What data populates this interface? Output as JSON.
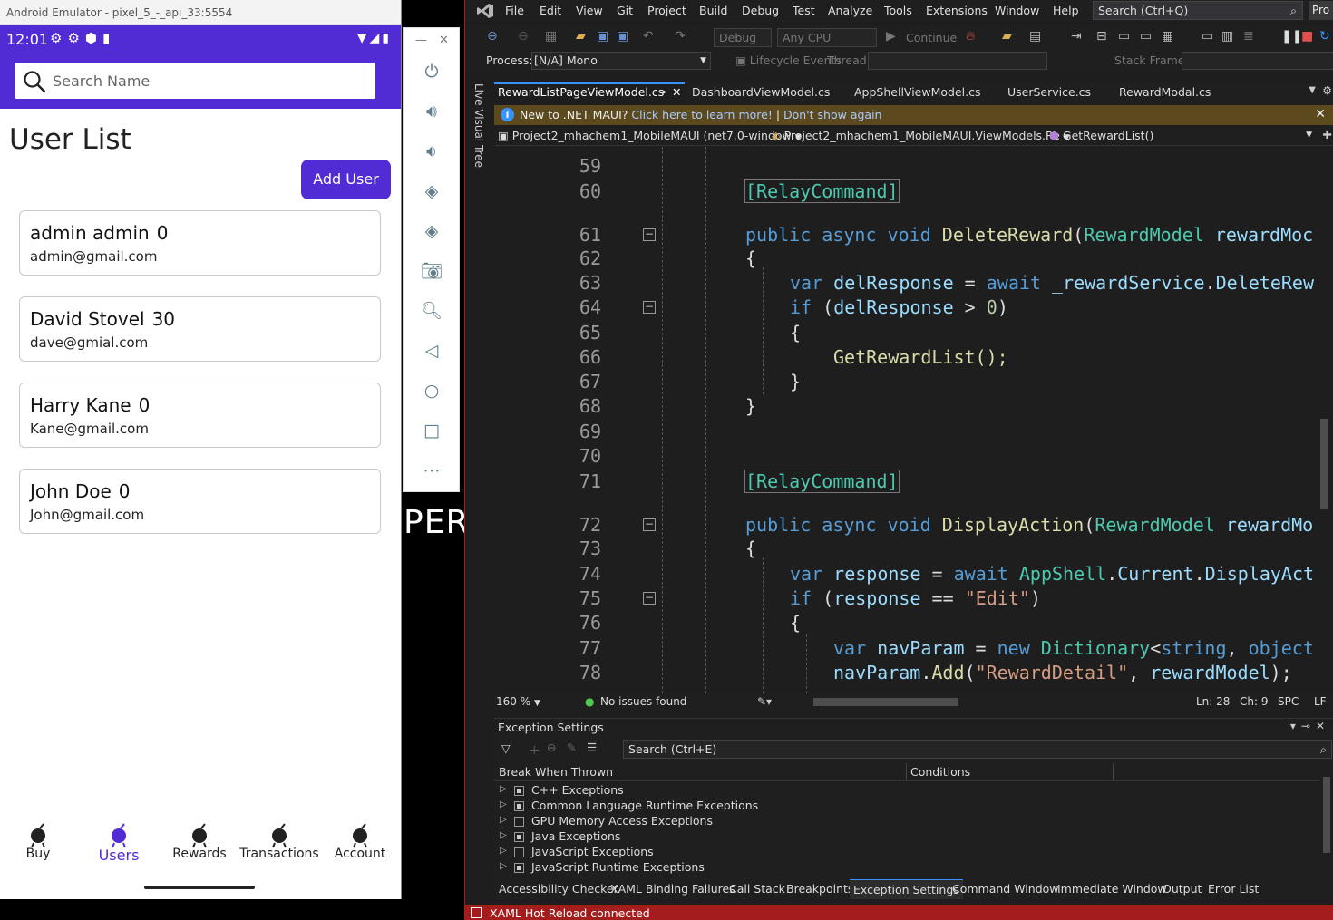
{
  "emulator": {
    "title": "Android Emulator - pixel_5_-_api_33:5554",
    "status_time": "12:01",
    "search_placeholder": "Search Name",
    "page_title": "User List",
    "add_user_label": "Add User",
    "users": [
      {
        "name": "admin admin",
        "points": "0",
        "email": "admin@gmail.com"
      },
      {
        "name": "David Stovel",
        "points": "30",
        "email": "dave@gmial.com"
      },
      {
        "name": "Harry Kane",
        "points": "0",
        "email": "Kane@gmail.com"
      },
      {
        "name": "John Doe",
        "points": "0",
        "email": "John@gmail.com"
      }
    ],
    "tabs": [
      {
        "label": "Buy",
        "active": false
      },
      {
        "label": "Users",
        "active": true
      },
      {
        "label": "Rewards",
        "active": false
      },
      {
        "label": "Transactions",
        "active": false
      },
      {
        "label": "Account",
        "active": false
      }
    ],
    "accent_color": "#512bd4",
    "background_text": "PER"
  },
  "emulator_sidebar": {
    "icons": [
      "power-icon",
      "volume-up-icon",
      "volume-down-icon",
      "rotate-left-icon",
      "rotate-right-icon",
      "camera-icon",
      "zoom-icon",
      "back-icon",
      "home-icon",
      "overview-icon",
      "more-icon"
    ]
  },
  "vs": {
    "menu": [
      "File",
      "Edit",
      "View",
      "Git",
      "Project",
      "Build",
      "Debug",
      "Test",
      "Analyze",
      "Tools",
      "Extensions",
      "Window",
      "Help"
    ],
    "search_placeholder": "Search (Ctrl+Q)",
    "pro_label": "Pro",
    "toolbar": {
      "config": "Debug",
      "platform": "Any CPU",
      "continue_label": "Continue"
    },
    "process_label": "Process:",
    "process_value": "[N/A] Mono",
    "lifecycle_label": "Lifecycle Events",
    "thread_label": "Thread:",
    "stackframe_label": "Stack Frame:",
    "live_visual_tree": "Live Visual Tree",
    "doc_tabs": [
      "RewardListPageViewModel.cs",
      "DashboardViewModel.cs",
      "AppShellViewModel.cs",
      "UserService.cs",
      "RewardModal.cs"
    ],
    "infobar": {
      "message": "New to .NET MAUI?",
      "link1": "Click here to learn more!",
      "separator": "|",
      "link2": "Don't show again"
    },
    "nav": {
      "project": "Project2_mhachem1_MobileMAUI (net7.0-window",
      "class": "Project2_mhachem1_MobileMAUI.ViewModels.Re",
      "member": "GetRewardList()"
    },
    "code_lines": [
      {
        "n": "59",
        "text": ""
      },
      {
        "n": "60",
        "text": "[RelayCommand]"
      },
      {
        "n": "61",
        "text": "public async void DeleteReward(RewardModel rewardMoc"
      },
      {
        "n": "62",
        "text": "{"
      },
      {
        "n": "63",
        "text": "var delResponse = await _rewardService.DeleteRew"
      },
      {
        "n": "64",
        "text": "if (delResponse > 0)"
      },
      {
        "n": "65",
        "text": "{"
      },
      {
        "n": "66",
        "text": "GetRewardList();"
      },
      {
        "n": "67",
        "text": "}"
      },
      {
        "n": "68",
        "text": "}"
      },
      {
        "n": "69",
        "text": ""
      },
      {
        "n": "70",
        "text": ""
      },
      {
        "n": "71",
        "text": "[RelayCommand]"
      },
      {
        "n": "72",
        "text": "public async void DisplayAction(RewardModel rewardMo"
      },
      {
        "n": "73",
        "text": "{"
      },
      {
        "n": "74",
        "text": "var response = await AppShell.Current.DisplayAct"
      },
      {
        "n": "75",
        "text": "if (response == \"Edit\")"
      },
      {
        "n": "76",
        "text": "{"
      },
      {
        "n": "77",
        "text": "var navParam = new Dictionary<string, object"
      },
      {
        "n": "78",
        "text": "navParam.Add(\"RewardDetail\", rewardModel);"
      }
    ],
    "status": {
      "zoom": "160 %",
      "issues": "No issues found",
      "ln": "Ln: 28",
      "ch": "Ch: 9",
      "spc": "SPC",
      "lf": "LF"
    },
    "exceptions": {
      "title": "Exception Settings",
      "search_placeholder": "Search (Ctrl+E)",
      "col_break": "Break When Thrown",
      "col_conditions": "Conditions",
      "rows": [
        {
          "label": "C++ Exceptions",
          "filled": true
        },
        {
          "label": "Common Language Runtime Exceptions",
          "filled": true
        },
        {
          "label": "GPU Memory Access Exceptions",
          "filled": false
        },
        {
          "label": "Java Exceptions",
          "filled": true
        },
        {
          "label": "JavaScript Exceptions",
          "filled": false
        },
        {
          "label": "JavaScript Runtime Exceptions",
          "filled": true
        }
      ]
    },
    "bottom_tabs": [
      "Accessibility Checker",
      "XAML Binding Failures",
      "Call Stack",
      "Breakpoints",
      "Exception Settings",
      "Command Window",
      "Immediate Window",
      "Output",
      "Error List"
    ],
    "active_bottom_tab": "Exception Settings",
    "status_bar": "XAML Hot Reload connected",
    "status_bar_color": "#a51c1c"
  }
}
